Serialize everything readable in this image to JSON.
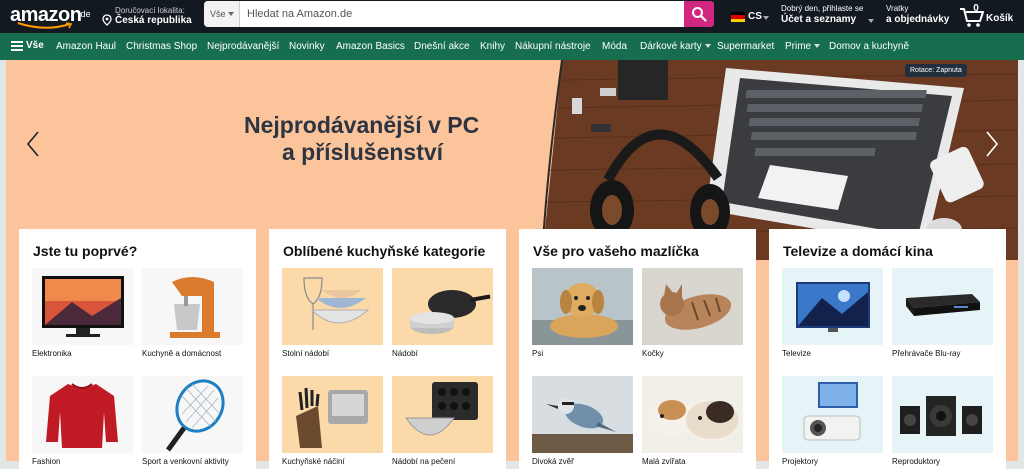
{
  "header": {
    "logo": {
      "text": "amazon",
      "tld": ".de"
    },
    "location": {
      "line1": "Doručovací lokalita:",
      "line2": "Česká republika"
    },
    "search": {
      "category": "Vše",
      "placeholder": "Hledat na Amazon.de"
    },
    "language": {
      "code": "CS"
    },
    "account": {
      "line1": "Dobrý den, přihlaste se",
      "line2": "Účet a seznamy"
    },
    "orders": {
      "line1": "Vratky",
      "line2": "a objednávky"
    },
    "cart": {
      "count": "0",
      "label": "Košík"
    }
  },
  "nav": {
    "all_label": "Vše",
    "items": [
      {
        "label": "Amazon Haul"
      },
      {
        "label": "Christmas Shop"
      },
      {
        "label": "Nejprodávanější"
      },
      {
        "label": "Novinky"
      },
      {
        "label": "Amazon Basics"
      },
      {
        "label": "Dnešní akce"
      },
      {
        "label": "Knihy"
      },
      {
        "label": "Nákupní nástroje"
      },
      {
        "label": "Móda"
      },
      {
        "label": "Dárkové karty"
      },
      {
        "label": "Supermarket"
      },
      {
        "label": "Prime"
      },
      {
        "label": "Domov a kuchyně"
      }
    ]
  },
  "hero": {
    "title_line1": "Nejprodávanější v PC",
    "title_line2": "a příslušenství",
    "rotation_label": "Rotace: Zapnuta"
  },
  "cards": [
    {
      "title": "Jste tu poprvé?",
      "tiles": [
        {
          "label": "Elektronika",
          "icon": "monitor-icon"
        },
        {
          "label": "Kuchyně a domácnost",
          "icon": "stand-mixer-icon"
        },
        {
          "label": "Fashion",
          "icon": "sweater-icon"
        },
        {
          "label": "Sport a venkovní aktivity",
          "icon": "tennis-racket-icon"
        }
      ]
    },
    {
      "title": "Oblíbené kuchyňské kategorie",
      "tiles": [
        {
          "label": "Stolní nádobí",
          "icon": "tableware-icon"
        },
        {
          "label": "Nádobí",
          "icon": "cookware-icon"
        },
        {
          "label": "Kuchyňské náčiní",
          "icon": "knife-block-icon"
        },
        {
          "label": "Nádobí na pečení",
          "icon": "baking-tray-icon"
        }
      ]
    },
    {
      "title": "Vše pro vašeho mazlíčka",
      "tiles": [
        {
          "label": "Psi",
          "icon": "dog-icon"
        },
        {
          "label": "Kočky",
          "icon": "cat-icon"
        },
        {
          "label": "Divoká zvěř",
          "icon": "bird-icon"
        },
        {
          "label": "Malá zvířata",
          "icon": "guinea-pig-icon"
        }
      ]
    },
    {
      "title": "Televize a domácí kina",
      "tiles": [
        {
          "label": "Televize",
          "icon": "tv-icon"
        },
        {
          "label": "Přehrávače Blu-ray",
          "icon": "bluray-player-icon"
        },
        {
          "label": "Projektory",
          "icon": "projector-icon"
        },
        {
          "label": "Reproduktory",
          "icon": "speakers-icon"
        }
      ]
    }
  ],
  "colors": {
    "topbar": "#131921",
    "navbar": "#166e4e",
    "search_button": "#d2277f",
    "hero_bg": "#fbc49b"
  }
}
